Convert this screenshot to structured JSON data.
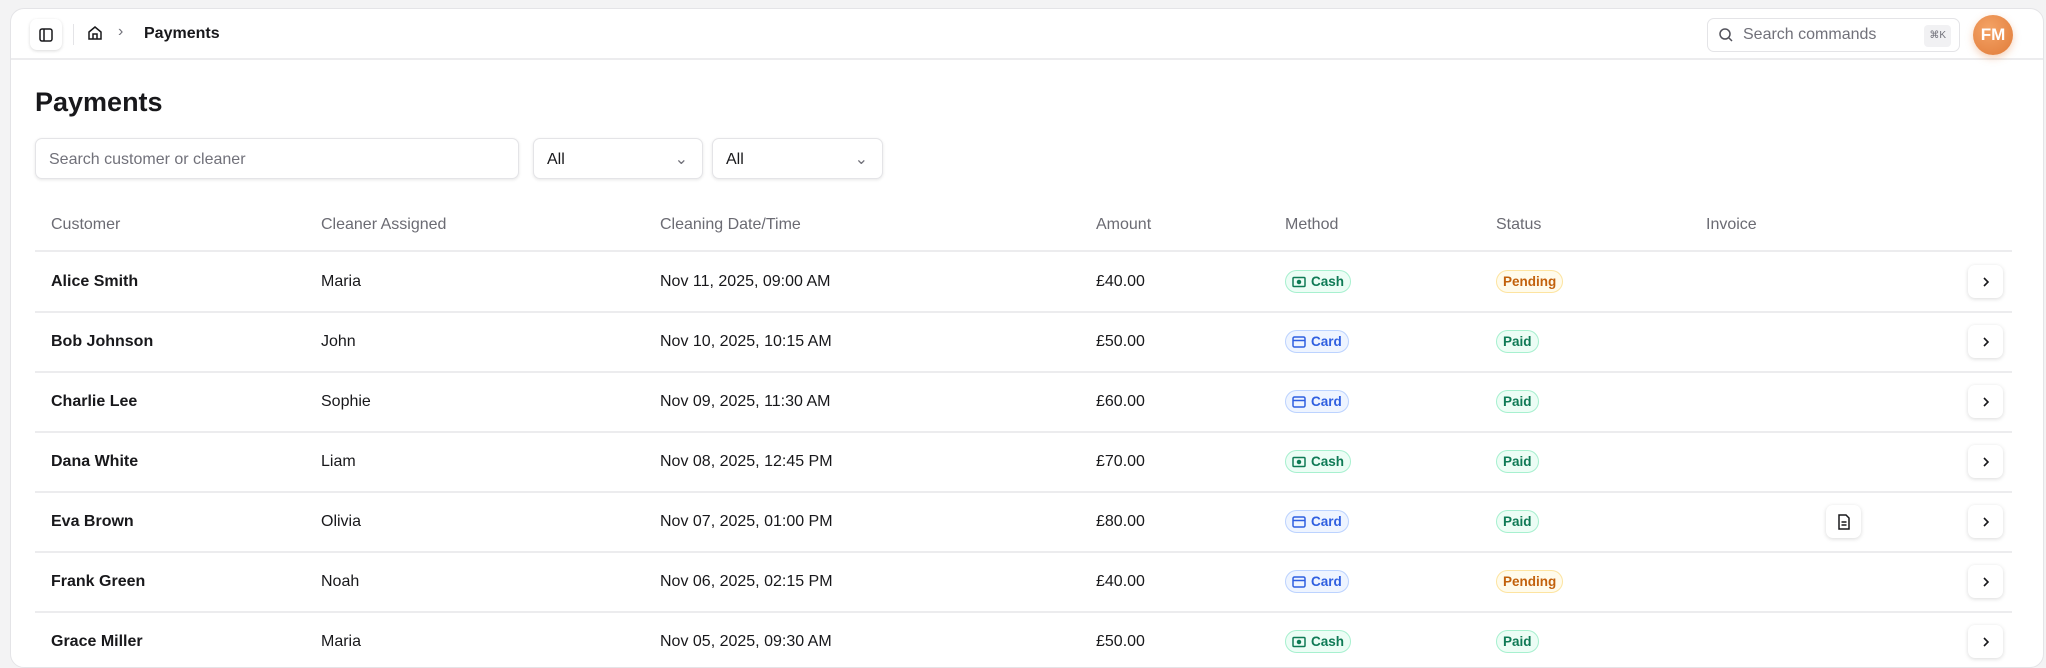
{
  "header": {
    "breadcrumb_current": "Payments",
    "command_search_placeholder": "Search commands",
    "command_shortcut": "⌘K",
    "avatar_initials": "FM"
  },
  "page": {
    "title": "Payments"
  },
  "filters": {
    "search_placeholder": "Search customer or cleaner",
    "method_value": "All",
    "status_value": "All"
  },
  "table": {
    "columns": [
      "Customer",
      "Cleaner Assigned",
      "Cleaning Date/Time",
      "Amount",
      "Method",
      "Status",
      "Invoice"
    ],
    "rows": [
      {
        "customer": "Alice Smith",
        "cleaner": "Maria",
        "datetime": "Nov 11, 2025, 09:00 AM",
        "amount": "£40.00",
        "method": "Cash",
        "status": "Pending",
        "invoice": false
      },
      {
        "customer": "Bob Johnson",
        "cleaner": "John",
        "datetime": "Nov 10, 2025, 10:15 AM",
        "amount": "£50.00",
        "method": "Card",
        "status": "Paid",
        "invoice": false
      },
      {
        "customer": "Charlie Lee",
        "cleaner": "Sophie",
        "datetime": "Nov 09, 2025, 11:30 AM",
        "amount": "£60.00",
        "method": "Card",
        "status": "Paid",
        "invoice": false
      },
      {
        "customer": "Dana White",
        "cleaner": "Liam",
        "datetime": "Nov 08, 2025, 12:45 PM",
        "amount": "£70.00",
        "method": "Cash",
        "status": "Paid",
        "invoice": false
      },
      {
        "customer": "Eva Brown",
        "cleaner": "Olivia",
        "datetime": "Nov 07, 2025, 01:00 PM",
        "amount": "£80.00",
        "method": "Card",
        "status": "Paid",
        "invoice": true
      },
      {
        "customer": "Frank Green",
        "cleaner": "Noah",
        "datetime": "Nov 06, 2025, 02:15 PM",
        "amount": "£40.00",
        "method": "Card",
        "status": "Pending",
        "invoice": false
      },
      {
        "customer": "Grace Miller",
        "cleaner": "Maria",
        "datetime": "Nov 05, 2025, 09:30 AM",
        "amount": "£50.00",
        "method": "Cash",
        "status": "Paid",
        "invoice": false
      }
    ]
  },
  "colors": {
    "cash": "#0f7a55",
    "card": "#2f5fe0",
    "paid": "#0f7a55",
    "pending": "#c2610c",
    "avatar": "#e88a47"
  }
}
